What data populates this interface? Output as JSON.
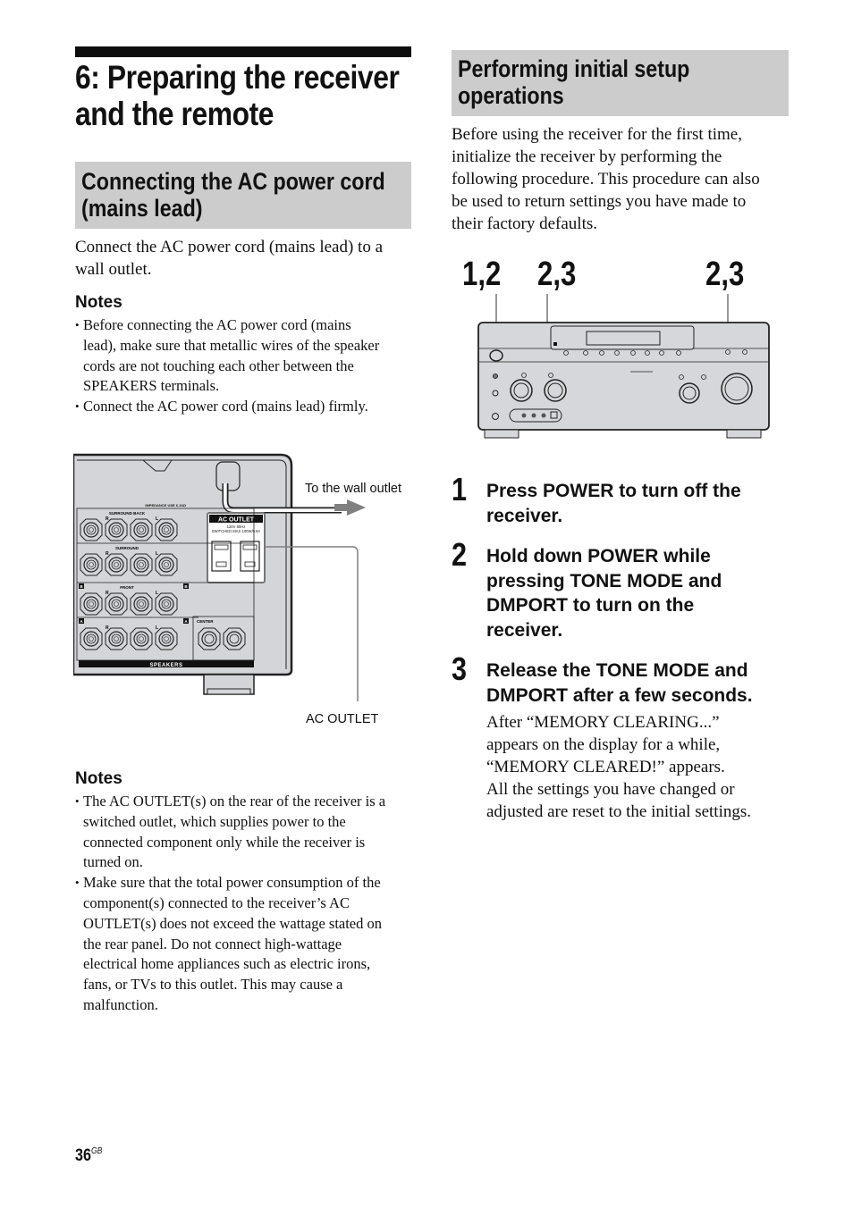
{
  "chapter": {
    "title": "6: Preparing the receiver and the remote"
  },
  "left_section": {
    "title_line1": "Connecting the AC power cord",
    "title_line2": "(mains lead)",
    "intro_line1": "Connect the AC power cord (mains lead) to a",
    "intro_line2": "wall outlet.",
    "notes_heading": "Notes",
    "notes": [
      [
        "Before connecting the AC power cord (mains",
        "lead), make sure that metallic wires of the speaker",
        "cords are not touching each other between the",
        "SPEAKERS terminals."
      ],
      [
        "Connect the AC power cord (mains lead) firmly."
      ]
    ],
    "figure": {
      "label_wall": "To the wall outlet",
      "label_outlet": "AC OUTLET",
      "panel_outlet_title": "AC OUTLET",
      "panel_outlet_spec1": "120V 60Hz",
      "panel_outlet_spec2": "SWITCHED MAX 100W/0.8A",
      "impedance_label": "IMPEDANCE USE 6-16Ω",
      "group_surround_back": "SURROUND BACK",
      "group_surround": "SURROUND",
      "group_front": "FRONT",
      "group_center": "CENTER",
      "speakers_bar": "SPEAKERS",
      "channel_r": "R",
      "channel_l": "L",
      "badge_b": "B",
      "badge_a": "A"
    },
    "notes2_heading": "Notes",
    "notes2": [
      [
        "The AC OUTLET(s) on the rear of the receiver is a",
        "switched outlet, which supplies power to the",
        "connected component only while the receiver is",
        "turned on."
      ],
      [
        "Make sure that the total power consumption of the",
        "component(s) connected to the receiver’s AC",
        "OUTLET(s) does not exceed the wattage stated on",
        "the rear panel. Do not connect high-wattage",
        "electrical home appliances such as electric irons,",
        "fans, or TVs to this outlet. This may cause a",
        "malfunction."
      ]
    ]
  },
  "right_section": {
    "title_line1": "Performing initial setup",
    "title_line2": "operations",
    "intro": [
      "Before using the receiver for the first time,",
      "initialize the receiver by performing the",
      "following procedure. This procedure can also",
      "be used to return settings you have made to",
      "their factory defaults."
    ],
    "callouts": [
      "1,2",
      "2,3",
      "2,3"
    ],
    "steps": [
      {
        "num": "1",
        "lines": [
          "Press POWER to turn off the",
          "receiver."
        ]
      },
      {
        "num": "2",
        "lines": [
          "Hold down POWER while",
          "pressing TONE MODE and",
          "DMPORT to turn on the",
          "receiver."
        ]
      },
      {
        "num": "3",
        "lines": [
          "Release the TONE MODE and",
          "DMPORT after a few seconds."
        ],
        "detail": [
          "After “MEMORY CLEARING...”",
          "appears on the display for a while,",
          "“MEMORY CLEARED!” appears.",
          "All the settings you have changed or",
          "adjusted are reset to the initial settings."
        ]
      }
    ]
  },
  "footer": {
    "page_number": "36",
    "page_suffix": "GB"
  }
}
